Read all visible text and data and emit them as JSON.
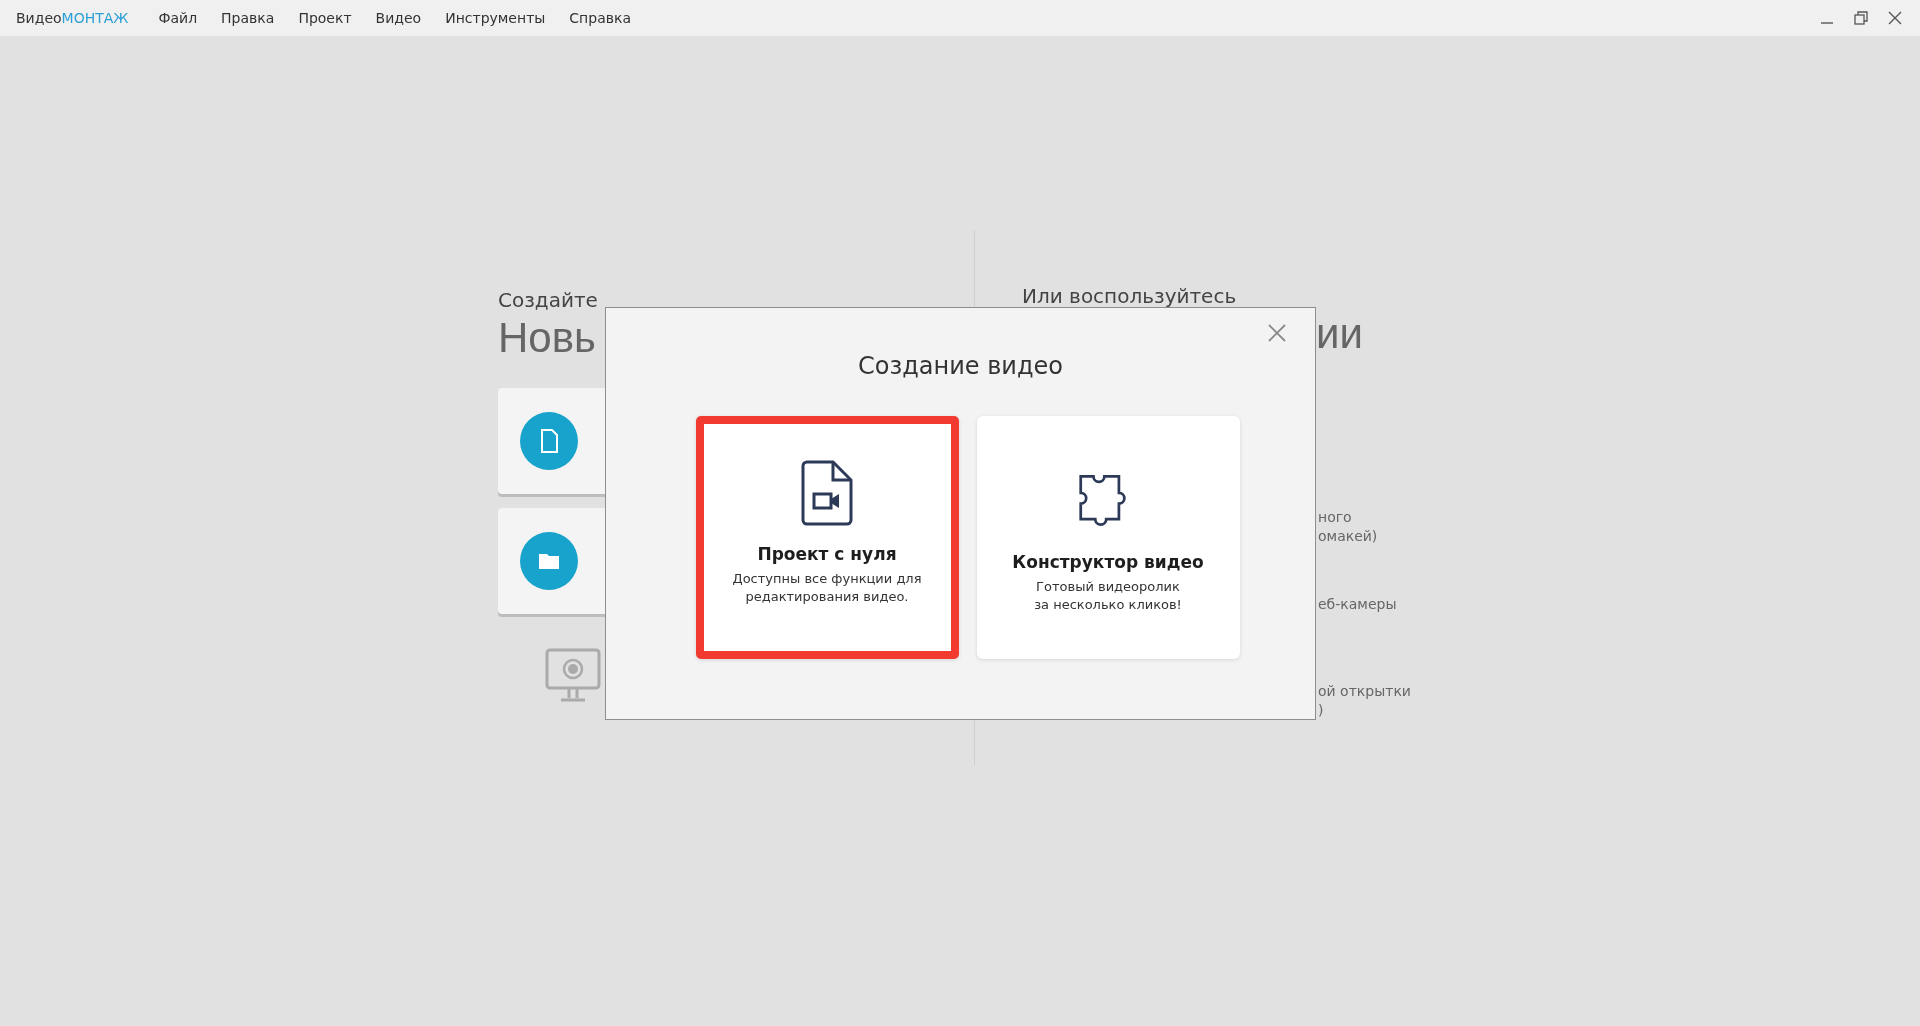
{
  "menu_bar": {
    "logo": {
      "part_1": "Видео",
      "part_2": "МОНТАЖ"
    },
    "items": [
      "Файл",
      "Правка",
      "Проект",
      "Видео",
      "Инструменты",
      "Справка"
    ]
  },
  "background": {
    "left": {
      "subtitle": "Создайте",
      "title": "Новь"
    },
    "right": {
      "subtitle": "Или воспользуйтесь",
      "title": "ии",
      "fragment_groups": [
        [
          "ного",
          "омакей)"
        ],
        [
          "еб-камеры"
        ],
        [
          "ой открытки",
          ")"
        ]
      ]
    }
  },
  "dialog": {
    "title": "Создание видео",
    "options": [
      {
        "kind": "project",
        "title": "Проект с нуля",
        "description": "Доступны все функции для\nредактирования видео.",
        "selected": true
      },
      {
        "kind": "constructor",
        "title": "Конструктор видео",
        "description": "Готовый видеоролик\nза несколько кликов!",
        "selected": false
      }
    ]
  }
}
